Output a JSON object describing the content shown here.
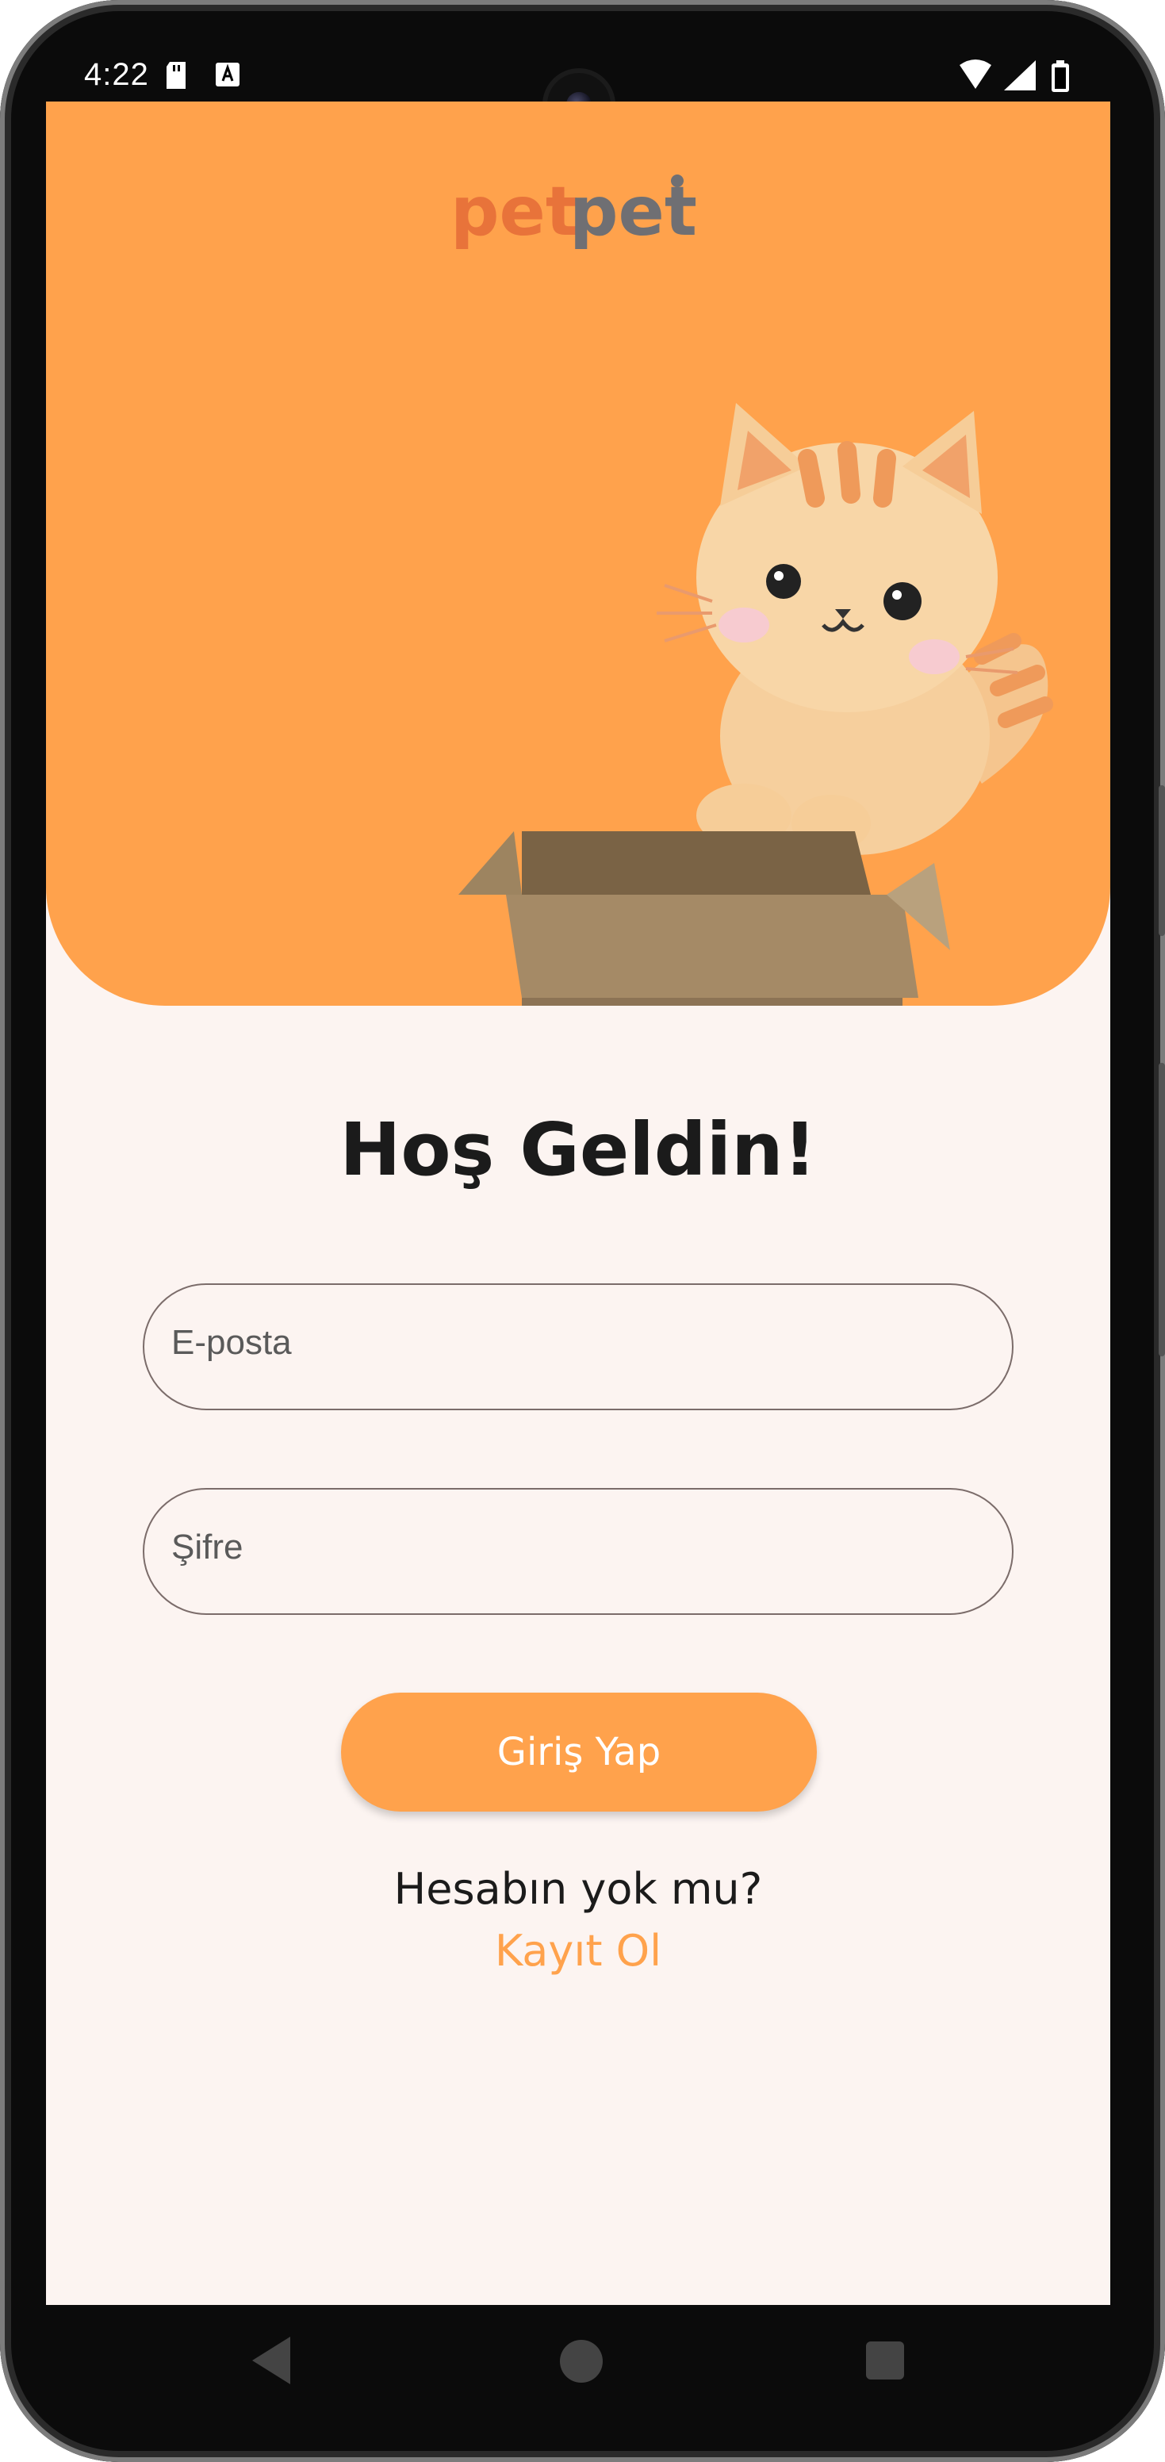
{
  "status_bar": {
    "time": "4:22",
    "icons": [
      "sd-card-icon",
      "a-keyboard-icon",
      "wifi-icon",
      "signal-icon",
      "battery-icon"
    ]
  },
  "header": {
    "logo_part1": "pet",
    "logo_part2": "pet",
    "logo_colors": [
      "#e8733a",
      "#6f6f73"
    ],
    "illustration": "cat-in-box"
  },
  "main": {
    "title": "Hoş Geldin!",
    "email_placeholder": "E-posta",
    "password_placeholder": "Şifre",
    "login_label": "Giriş Yap",
    "no_account_text": "Hesabın yok mu?",
    "register_label": "Kayıt Ol"
  },
  "nav": {
    "icons": [
      "back-icon",
      "home-icon",
      "recents-icon"
    ]
  },
  "colors": {
    "accent": "#ffa24c",
    "background": "#fcf4f1",
    "text": "#1b1b1b",
    "field_border": "#7b6c6a"
  }
}
